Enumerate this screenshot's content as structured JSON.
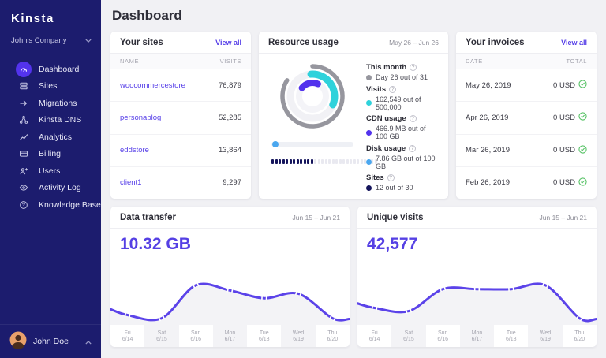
{
  "sidebar": {
    "logo": "Kinsta",
    "company": "John's Company",
    "items": [
      {
        "label": "Dashboard",
        "icon": "dashboard",
        "active": true
      },
      {
        "label": "Sites",
        "icon": "sites"
      },
      {
        "label": "Migrations",
        "icon": "migrations"
      },
      {
        "label": "Kinsta DNS",
        "icon": "dns"
      },
      {
        "label": "Analytics",
        "icon": "analytics"
      },
      {
        "label": "Billing",
        "icon": "billing"
      },
      {
        "label": "Users",
        "icon": "users"
      },
      {
        "label": "Activity Log",
        "icon": "activity"
      },
      {
        "label": "Knowledge Base",
        "icon": "knowledge"
      }
    ],
    "user": "John Doe"
  },
  "header": {
    "title": "Dashboard"
  },
  "sites_card": {
    "title": "Your sites",
    "view_all": "View all",
    "columns": {
      "name": "Name",
      "visits": "Visits"
    },
    "rows": [
      {
        "name": "woocommercestore",
        "visits": "76,879"
      },
      {
        "name": "personablog",
        "visits": "52,285"
      },
      {
        "name": "eddstore",
        "visits": "13,864"
      },
      {
        "name": "client1",
        "visits": "9,297"
      }
    ]
  },
  "resource_card": {
    "title": "Resource usage",
    "range": "May 26 – Jun 26",
    "help_glyph": "?",
    "metrics": [
      {
        "label": "This month",
        "value": "Day 26 out of 31",
        "color": "#96969e",
        "fraction": 0.839
      },
      {
        "label": "Visits",
        "value": "162,549 out of 500,000",
        "color": "#2fd2db",
        "fraction": 0.325
      },
      {
        "label": "CDN usage",
        "value": "466.9 MB out of 100 GB",
        "color": "#5333ed",
        "fraction": 0.005
      },
      {
        "label": "Disk usage",
        "value": "7.86 GB out of 100 GB",
        "color": "#4aa7ef",
        "fraction": 0.079
      },
      {
        "label": "Sites",
        "value": "12 out of 30",
        "color": "#15155c",
        "used": 12,
        "total": 30
      }
    ]
  },
  "invoices_card": {
    "title": "Your invoices",
    "view_all": "View all",
    "columns": {
      "date": "Date",
      "total": "Total"
    },
    "rows": [
      {
        "date": "May 26, 2019",
        "total": "0 USD"
      },
      {
        "date": "Apr 26, 2019",
        "total": "0 USD"
      },
      {
        "date": "Mar 26, 2019",
        "total": "0 USD"
      },
      {
        "date": "Feb 26, 2019",
        "total": "0 USD"
      }
    ]
  },
  "chart_data": [
    {
      "type": "area",
      "title": "Data transfer",
      "range": "Jun 15 – Jun 21",
      "big_value": "10.32 GB",
      "color": "#5b43e9",
      "days": [
        {
          "day": "Fri",
          "date": "6/14"
        },
        {
          "day": "Sat",
          "date": "6/15"
        },
        {
          "day": "Sun",
          "date": "6/16"
        },
        {
          "day": "Mon",
          "date": "6/17"
        },
        {
          "day": "Tue",
          "date": "6/18"
        },
        {
          "day": "Wed",
          "date": "6/19"
        },
        {
          "day": "Thu",
          "date": "6/20"
        }
      ],
      "values_relative": [
        0.23,
        0.14,
        0.09,
        0.6,
        0.52,
        0.4,
        0.47,
        0.09,
        0.08
      ]
    },
    {
      "type": "area",
      "title": "Unique visits",
      "range": "Jun 15 – Jun 21",
      "big_value": "42,577",
      "color": "#5b43e9",
      "days": [
        {
          "day": "Fri",
          "date": "6/14"
        },
        {
          "day": "Sat",
          "date": "6/15"
        },
        {
          "day": "Sun",
          "date": "6/16"
        },
        {
          "day": "Mon",
          "date": "6/17"
        },
        {
          "day": "Tue",
          "date": "6/18"
        },
        {
          "day": "Wed",
          "date": "6/19"
        },
        {
          "day": "Thu",
          "date": "6/20"
        }
      ],
      "values_relative": [
        0.32,
        0.25,
        0.2,
        0.54,
        0.54,
        0.54,
        0.6,
        0.09,
        0.08
      ]
    }
  ]
}
